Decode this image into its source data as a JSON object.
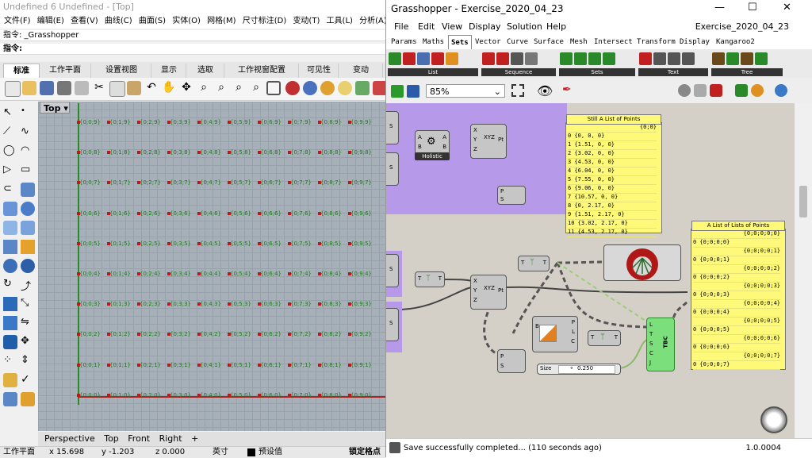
{
  "rhino": {
    "title": "Undefined 6 Undefined - [Top]",
    "menu": [
      "文件(F)",
      "编辑(E)",
      "查看(V)",
      "曲线(C)",
      "曲面(S)",
      "实体(O)",
      "网格(M)",
      "尺寸标注(D)",
      "变动(T)",
      "工具(L)",
      "分析(A)",
      "渲"
    ],
    "command_history": "指令: _Grasshopper",
    "command_prompt": "指令:",
    "toolbar_tabs": [
      "标准",
      "工作平面",
      "设置视图",
      "显示",
      "选取",
      "工作视窗配置",
      "可见性",
      "变动"
    ],
    "viewport_label": "Top",
    "viewport_tabs": [
      "Perspective",
      "Top",
      "Front",
      "Right",
      "+"
    ],
    "status": {
      "plane": "工作平面",
      "x": "x 15.698",
      "y": "y -1.203",
      "z": "z 0.000",
      "unit": "英寸",
      "layer": "预设值",
      "snap": "锁定格点"
    },
    "point_rows": [
      [
        "{0;0;9}",
        "{0;1;9}",
        "{0;2;9}",
        "{0;3;9}",
        "{0;4;9}",
        "{0;5;9}",
        "{0;6;9}",
        "{0;7;9}",
        "{0;8;9}",
        "{0;9;9}"
      ],
      [
        "{0;0;8}",
        "{0;1;8}",
        "{0;2;8}",
        "{0;3;8}",
        "{0;4;8}",
        "{0;5;8}",
        "{0;6;8}",
        "{0;7;8}",
        "{0;8;8}",
        "{0;9;8}"
      ],
      [
        "{0;0;7}",
        "{0;1;7}",
        "{0;2;7}",
        "{0;3;7}",
        "{0;4;7}",
        "{0;5;7}",
        "{0;6;7}",
        "{0;7;7}",
        "{0;8;7}",
        "{0;9;7}"
      ],
      [
        "{0;0;6}",
        "{0;1;6}",
        "{0;2;6}",
        "{0;3;6}",
        "{0;4;6}",
        "{0;5;6}",
        "{0;6;6}",
        "{0;7;6}",
        "{0;8;6}",
        "{0;9;6}"
      ],
      [
        "{0;0;5}",
        "{0;1;5}",
        "{0;2;5}",
        "{0;3;5}",
        "{0;4;5}",
        "{0;5;5}",
        "{0;6;5}",
        "{0;7;5}",
        "{0;8;5}",
        "{0;9;5}"
      ],
      [
        "{0;0;4}",
        "{0;1;4}",
        "{0;2;4}",
        "{0;3;4}",
        "{0;4;4}",
        "{0;5;4}",
        "{0;6;4}",
        "{0;7;4}",
        "{0;8;4}",
        "{0;9;4}"
      ],
      [
        "{0;0;3}",
        "{0;1;3}",
        "{0;2;3}",
        "{0;3;3}",
        "{0;4;3}",
        "{0;5;3}",
        "{0;6;3}",
        "{0;7;3}",
        "{0;8;3}",
        "{0;9;3}"
      ],
      [
        "{0;0;2}",
        "{0;1;2}",
        "{0;2;2}",
        "{0;3;2}",
        "{0;4;2}",
        "{0;5;2}",
        "{0;6;2}",
        "{0;7;2}",
        "{0;8;2}",
        "{0;9;2}"
      ],
      [
        "{0;0;1}",
        "{0;1;1}",
        "{0;2;1}",
        "{0;3;1}",
        "{0;4;1}",
        "{0;5;1}",
        "{0;6;1}",
        "{0;7;1}",
        "{0;8;1}",
        "{0;9;1}"
      ],
      [
        "{0;0;0}",
        "{0;1;0}",
        "{0;2;0}",
        "{0;3;0}",
        "{0;4;0}",
        "{0;5;0}",
        "{0;6;0}",
        "{0;7;0}",
        "{0;8;0}",
        "{0;9;0}"
      ]
    ]
  },
  "gh": {
    "title": "Grasshopper - Exercise_2020_04_23",
    "document_name": "Exercise_2020_04_23",
    "menu": [
      "File",
      "Edit",
      "View",
      "Display",
      "Solution",
      "Help"
    ],
    "tabs": [
      "Params",
      "Maths",
      "Sets",
      "Vector",
      "Curve",
      "Surface",
      "Mesh",
      "Intersect",
      "Transform",
      "Display",
      "Kangaroo2"
    ],
    "active_tab": "Sets",
    "ribbon_groups": [
      "List",
      "Sequence",
      "Sets",
      "Text",
      "Tree"
    ],
    "zoom": "85%",
    "components": {
      "holistic": "Holistic",
      "pt_inputs": [
        "X",
        "Y",
        "Z"
      ],
      "pt_output": "Pt",
      "flatten_label": "T",
      "slider_label": "Size",
      "slider_value": "0.250",
      "tbc_label": "TBC",
      "tbc_inputs": [
        "L",
        "T",
        "S",
        "C",
        "J"
      ]
    },
    "panel1": {
      "title": "Still A List of Points",
      "path": "{0;0}",
      "rows": [
        "0 {0, 0, 0}",
        "1 {1.51, 0, 0}",
        "2 {3.02, 0, 0}",
        "3 {4.53, 0, 0}",
        "4 {6.04, 0, 0}",
        "5 {7.55, 0, 0}",
        "6 {9.06, 0, 0}",
        "7 {10.57, 0, 0}",
        "8 {0, 2.17, 0}",
        "9 {1.51, 2.17, 0}",
        "10 {3.02, 2.17, 0}",
        "11 {4.53, 2.17, 0}"
      ]
    },
    "panel2": {
      "title": "A List of Lists of Points",
      "rows": [
        "{0;0;0;0;0}",
        "0 {0;0;0;0}",
        "{0;0;0;0;1}",
        "0 {0;0;0;1}",
        "{0;0;0;0;2}",
        "0 {0;0;0;2}",
        "{0;0;0;0;3}",
        "0 {0;0;0;3}",
        "{0;0;0;0;4}",
        "0 {0;0;0;4}",
        "{0;0;0;0;5}",
        "0 {0;0;0;5}",
        "{0;0;0;0;6}",
        "0 {0;0;0;6}",
        "{0;0;0;0;7}",
        "0 {0;0;0;7}"
      ]
    },
    "status_message": "Save successfully completed... (110 seconds ago)",
    "version": "1.0.0004"
  }
}
